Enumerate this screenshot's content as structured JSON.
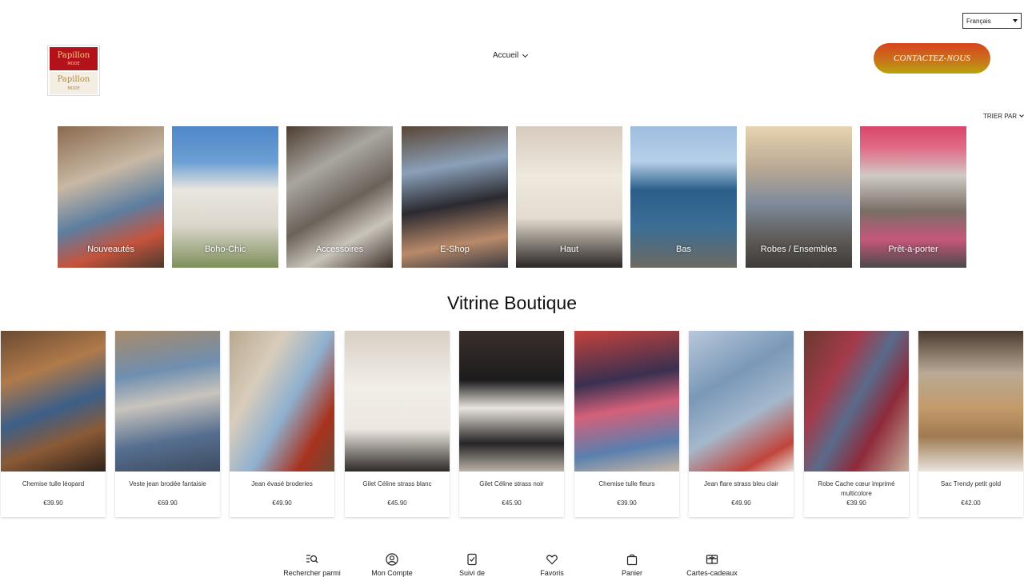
{
  "language_selector": {
    "value": "Français"
  },
  "logo": {
    "line1": "Papillon",
    "line2": "MODE",
    "line3": "Papillon",
    "line4": "MODE"
  },
  "nav": {
    "home": "Accueil"
  },
  "contact_button": "CONTACTEZ-NOUS",
  "sort_label": "TRIER PAR",
  "categories": [
    {
      "label": "Nouveautés"
    },
    {
      "label": "Boho-Chic"
    },
    {
      "label": "Accessoires"
    },
    {
      "label": "E-Shop"
    },
    {
      "label": "Haut"
    },
    {
      "label": "Bas"
    },
    {
      "label": "Robes / Ensembles"
    },
    {
      "label": "Prêt-à-porter"
    }
  ],
  "section_title": "Vitrine Boutique",
  "products": [
    {
      "name": "Chemise tulle léopard",
      "price": "€39.90"
    },
    {
      "name": "Veste jean brodée fantaisie",
      "price": "€69.90"
    },
    {
      "name": "Jean évasé broderies",
      "price": "€49.90"
    },
    {
      "name": "Gilet Céline strass blanc",
      "price": "€45.90"
    },
    {
      "name": "Gilet Céline strass noir",
      "price": "€45.90"
    },
    {
      "name": "Chemise tulle fleurs",
      "price": "€39.90"
    },
    {
      "name": "Jean flare strass bleu clair",
      "price": "€49.90"
    },
    {
      "name": "Robe Cache cœur imprimé multicolore",
      "price": "€39.90"
    },
    {
      "name": "Sac Trendy petit gold",
      "price": "€42.00"
    }
  ],
  "bottom_nav": [
    {
      "label": "Rechercher parmi",
      "icon": "search-list-icon"
    },
    {
      "label": "Mon Compte",
      "icon": "user-icon"
    },
    {
      "label": "Suivi de",
      "icon": "order-tracking-icon"
    },
    {
      "label": "Favoris",
      "icon": "heart-icon"
    },
    {
      "label": "Panier",
      "icon": "bag-icon"
    },
    {
      "label": "Cartes-cadeaux",
      "icon": "gift-card-icon"
    }
  ],
  "colors": {
    "contact_gradient_start": "#d8431e",
    "contact_gradient_end": "#b9a40e",
    "logo_red": "#b3121b"
  }
}
